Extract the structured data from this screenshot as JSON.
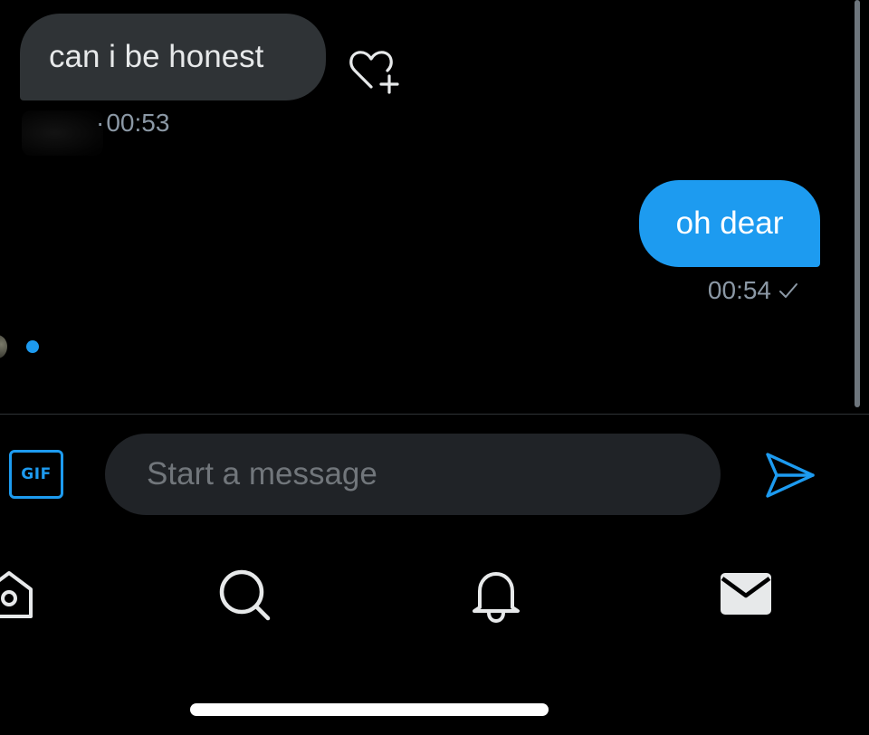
{
  "conversation": {
    "received_message": {
      "text": "can i be honest",
      "separator": "·",
      "time": "00:53",
      "reaction_icon": "heart-add-icon"
    },
    "sent_message": {
      "text": "oh dear",
      "time": "00:54",
      "status_icon": "check-icon"
    },
    "typing_indicator_icon": "typing-dot"
  },
  "composer": {
    "gif_label": "GIF",
    "placeholder": "Start a message",
    "send_icon": "send-icon"
  },
  "bottom_nav": {
    "items": [
      {
        "name": "home",
        "icon": "home-icon"
      },
      {
        "name": "search",
        "icon": "search-icon"
      },
      {
        "name": "notifications",
        "icon": "bell-icon"
      },
      {
        "name": "messages",
        "icon": "mail-icon"
      }
    ]
  },
  "colors": {
    "background": "#000000",
    "accent": "#1d9bf0",
    "received_bubble": "#2f3336",
    "input_background": "#202327",
    "secondary_text": "#8b98a5",
    "placeholder_text": "#71767b",
    "icon": "#e7e9ea"
  }
}
